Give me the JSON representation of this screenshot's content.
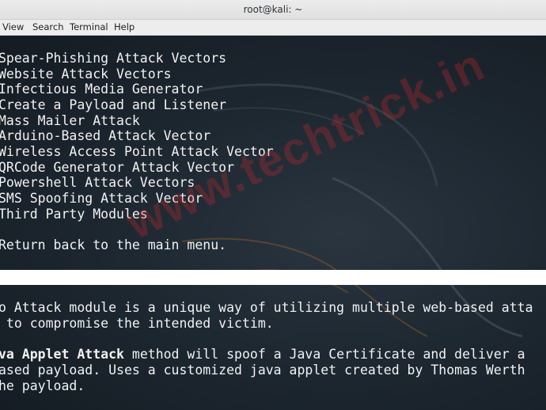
{
  "window": {
    "title": "root@kali: ~"
  },
  "menubar": {
    "items": [
      "View",
      "Search",
      "Terminal",
      "Help"
    ]
  },
  "terminal": {
    "menu_lines": [
      "Spear-Phishing Attack Vectors",
      "Website Attack Vectors",
      "Infectious Media Generator",
      "Create a Payload and Listener",
      "Mass Mailer Attack",
      "Arduino-Based Attack Vector",
      "Wireless Access Point Attack Vector",
      "QRCode Generator Attack Vector",
      "Powershell Attack Vectors",
      "SMS Spoofing Attack Vector",
      "Third Party Modules"
    ],
    "return_line": "Return back to the main menu.",
    "desc_line1": "o Attack module is a unique way of utilizing multiple web-based atta",
    "desc_line2": " to compromise the intended victim.",
    "desc_line3_bold": "va Applet Attack",
    "desc_line3_rest": " method will spoof a Java Certificate and deliver a",
    "desc_line4": "ased payload. Uses a customized java applet created by Thomas Werth",
    "desc_line5": "he payload."
  },
  "watermark": {
    "text": "www.techtrick.in"
  },
  "colors": {
    "terminal_bg": "#1e2831",
    "terminal_fg": "#f2f2f2",
    "watermark": "#dc2828",
    "titlebar": "#e6e6e6"
  }
}
